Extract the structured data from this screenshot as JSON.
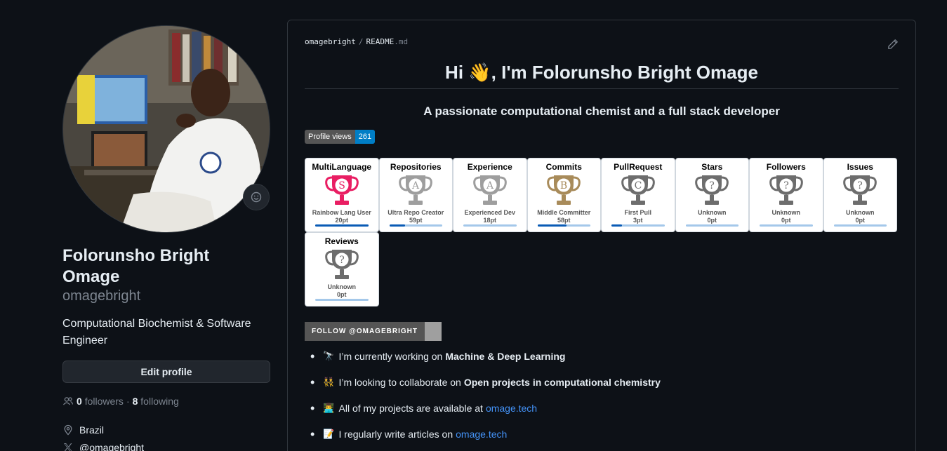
{
  "profile": {
    "full_name": "Folorunsho Bright Omage",
    "username": "omagebright",
    "bio": "Computational Biochemist & Software Engineer",
    "edit_label": "Edit profile",
    "followers_count": "0",
    "followers_label": "followers",
    "separator": "·",
    "following_count": "8",
    "following_label": "following",
    "location": "Brazil",
    "twitter": "@omagebright"
  },
  "readme": {
    "owner": "omagebright",
    "path_sep": "/",
    "file_base": "README",
    "file_ext": ".md",
    "heading": "Hi 👋, I'm Folorunsho Bright Omage",
    "subheading": "A passionate computational chemist and a full stack developer",
    "views_label": "Profile views",
    "views_count": "261",
    "follow_badge": "FOLLOW @OMAGEBRIGHT",
    "trophies": [
      {
        "title": "MultiLanguage",
        "rank": "Rainbow Lang User",
        "points": "20pt",
        "letter": "S",
        "progress": 1.0,
        "color": "#e91e63"
      },
      {
        "title": "Repositories",
        "rank": "Ultra Repo Creator",
        "points": "59pt",
        "letter": "A",
        "progress": 0.3,
        "color": "#9e9e9e"
      },
      {
        "title": "Experience",
        "rank": "Experienced Dev",
        "points": "18pt",
        "letter": "A",
        "progress": 0.0,
        "color": "#9e9e9e"
      },
      {
        "title": "Commits",
        "rank": "Middle Committer",
        "points": "58pt",
        "letter": "B",
        "progress": 0.55,
        "color": "#a88b5a"
      },
      {
        "title": "PullRequest",
        "rank": "First Pull",
        "points": "3pt",
        "letter": "C",
        "progress": 0.2,
        "color": "#6d6d6d"
      },
      {
        "title": "Stars",
        "rank": "Unknown",
        "points": "0pt",
        "letter": "?",
        "progress": 0.0,
        "color": "#6d6d6d"
      },
      {
        "title": "Followers",
        "rank": "Unknown",
        "points": "0pt",
        "letter": "?",
        "progress": 0.0,
        "color": "#6d6d6d"
      },
      {
        "title": "Issues",
        "rank": "Unknown",
        "points": "0pt",
        "letter": "?",
        "progress": 0.0,
        "color": "#6d6d6d"
      },
      {
        "title": "Reviews",
        "rank": "Unknown",
        "points": "0pt",
        "letter": "?",
        "progress": 0.0,
        "color": "#6d6d6d"
      }
    ],
    "bullets": [
      {
        "emoji": "🔭",
        "text": "I’m currently working on",
        "bold": "Machine & Deep Learning"
      },
      {
        "emoji": "👯",
        "text": "I’m looking to collaborate on",
        "bold": "Open projects in computational chemistry"
      },
      {
        "emoji": "👨‍💻",
        "text": "All of my projects are available at",
        "link": "omage.tech"
      },
      {
        "emoji": "📝",
        "text": "I regularly write articles on",
        "link": "omage.tech"
      }
    ]
  },
  "colors": {
    "bg": "#0d1117",
    "border": "#30363d",
    "muted": "#7d8590",
    "link": "#4493f8",
    "badge_blue": "#007ec6"
  }
}
